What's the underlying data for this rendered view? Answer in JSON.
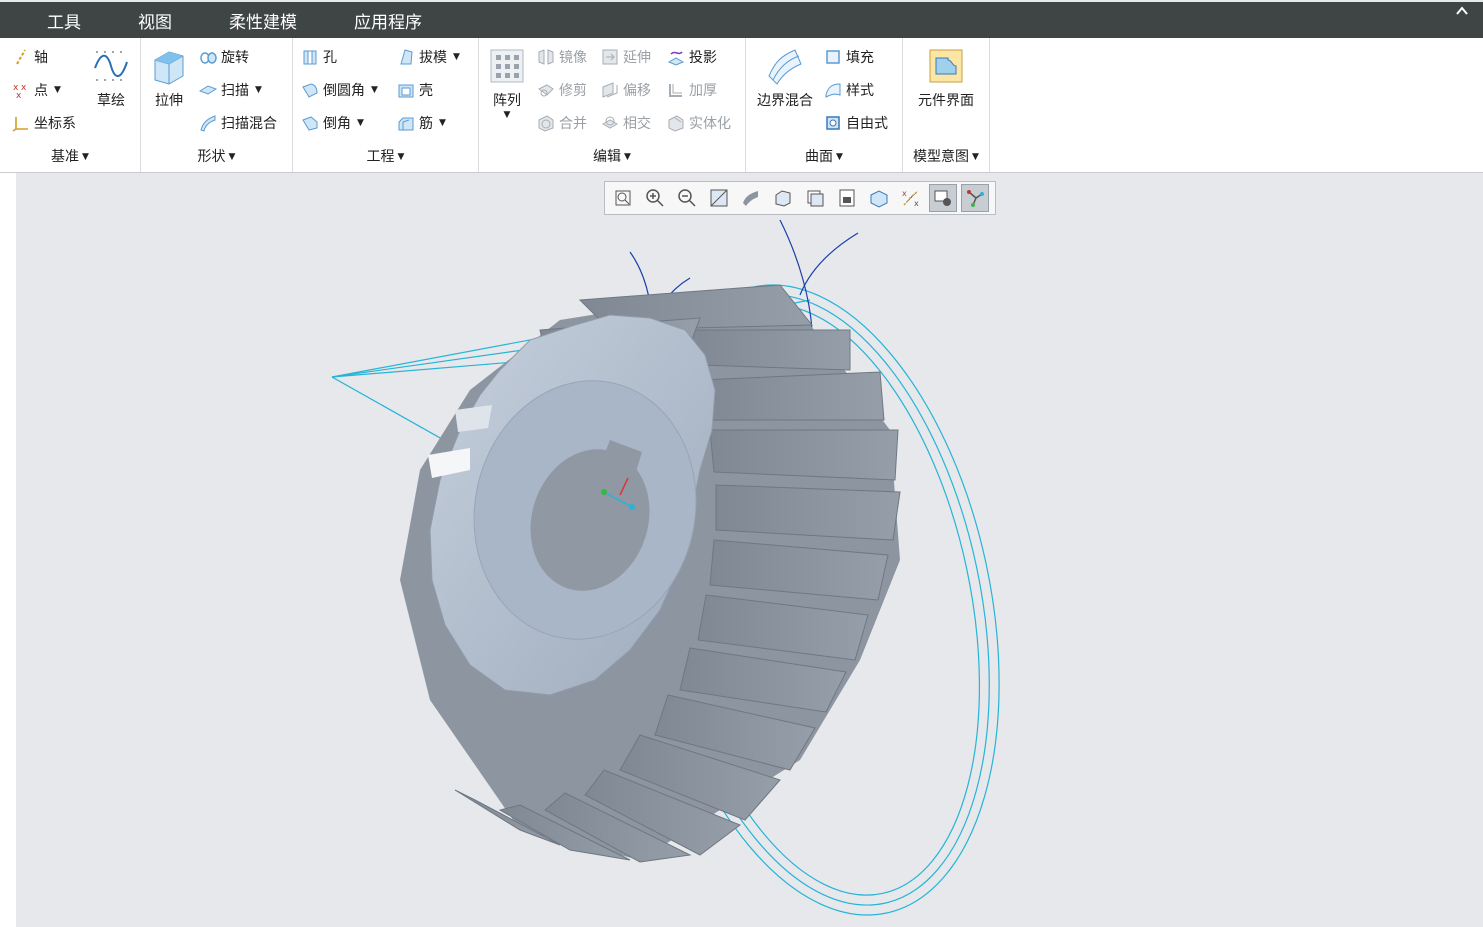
{
  "menu": {
    "tabs": [
      "工具",
      "视图",
      "柔性建模",
      "应用程序"
    ],
    "collapse_icon": "chevron-up-icon"
  },
  "ribbon": {
    "datum": {
      "label": "基准",
      "axis": "轴",
      "point": "点",
      "csys": "坐标系",
      "sketch": "草绘"
    },
    "shapes": {
      "label": "形状",
      "extrude": "拉伸",
      "revolve": "旋转",
      "sweep": "扫描",
      "swept_blend": "扫描混合"
    },
    "engineering": {
      "label": "工程",
      "hole": "孔",
      "round": "倒圆角",
      "chamfer": "倒角",
      "draft": "拔模",
      "shell": "壳",
      "rib": "筋"
    },
    "editing": {
      "label": "编辑",
      "pattern": "阵列",
      "mirror": "镜像",
      "extend": "延伸",
      "project": "投影",
      "trim": "修剪",
      "offset": "偏移",
      "thicken": "加厚",
      "merge": "合并",
      "intersect": "相交",
      "solidify": "实体化"
    },
    "surfaces": {
      "label": "曲面",
      "boundary_blend": "边界混合",
      "fill": "填充",
      "style": "样式",
      "freestyle": "自由式"
    },
    "model_intent": {
      "label": "模型意图",
      "component_interface": "元件界面"
    }
  },
  "view_toolbar": {
    "icons": [
      "refit-icon",
      "zoom-in-icon",
      "zoom-out-icon",
      "repaint-icon",
      "display-style-icon",
      "saved-orientations-icon",
      "view-manager-icon",
      "perspective-icon",
      "spin-center-icon",
      "datum-display-icon",
      "annotation-display-icon",
      "sketch-view-icon"
    ],
    "active": [
      "annotation-display-icon",
      "sketch-view-icon"
    ]
  },
  "colors": {
    "menubar": "#3f4444",
    "gear_face": "#a9b6c8",
    "gear_teeth": "#8c95a0",
    "datum_curve": "#27b4d6",
    "axis_line": "#1c3fa8"
  }
}
